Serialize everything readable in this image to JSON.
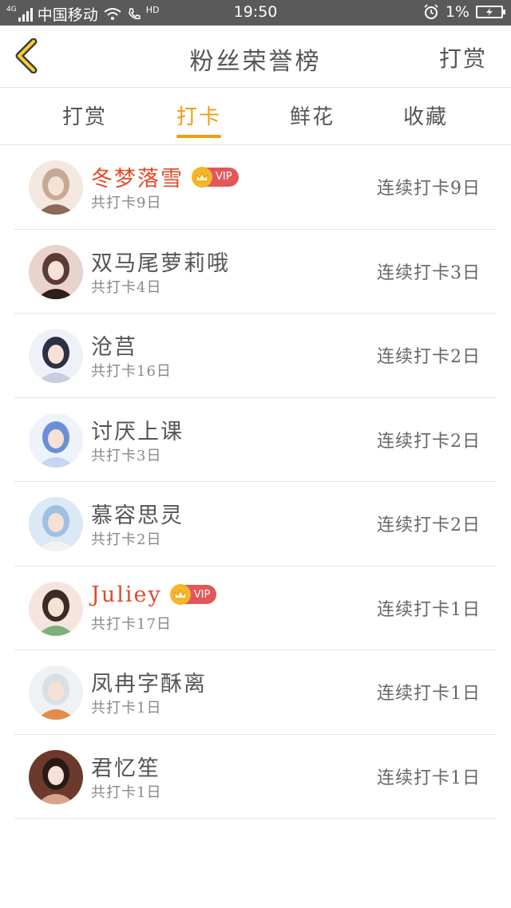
{
  "status_bar": {
    "network_type": "4G",
    "carrier": "中国移动",
    "hd_label": "HD",
    "time": "19:50",
    "battery_percent": "1%"
  },
  "header": {
    "back_icon": "chevron-left-icon",
    "title": "粉丝荣誉榜",
    "action_label": "打赏"
  },
  "tabs": [
    {
      "label": "打赏",
      "active": false
    },
    {
      "label": "打卡",
      "active": true
    },
    {
      "label": "鲜花",
      "active": false
    },
    {
      "label": "收藏",
      "active": false
    }
  ],
  "accent_color": "#f39c12",
  "vip_name_color": "#e14b2a",
  "vip_badge_label": "VIP",
  "fans": [
    {
      "name": "冬梦落雪",
      "vip": true,
      "total": "共打卡9日",
      "streak": "连续打卡9日",
      "avatar_colors": [
        "#f3e7df",
        "#c7a895",
        "#8a6a5c"
      ]
    },
    {
      "name": "双马尾萝莉哦",
      "vip": false,
      "total": "共打卡4日",
      "streak": "连续打卡3日",
      "avatar_colors": [
        "#e8d3cd",
        "#5b3b35",
        "#2e1e1c"
      ]
    },
    {
      "name": "沧莒",
      "vip": false,
      "total": "共打卡16日",
      "streak": "连续打卡2日",
      "avatar_colors": [
        "#eef1f8",
        "#2c3043",
        "#c8cede"
      ]
    },
    {
      "name": "讨厌上课",
      "vip": false,
      "total": "共打卡3日",
      "streak": "连续打卡2日",
      "avatar_colors": [
        "#eef3fb",
        "#6b8fd6",
        "#c8d5f0"
      ]
    },
    {
      "name": "慕容思灵",
      "vip": false,
      "total": "共打卡2日",
      "streak": "连续打卡2日",
      "avatar_colors": [
        "#dbe9f6",
        "#9fc0e3",
        "#f2f2f6"
      ]
    },
    {
      "name": "Juliey",
      "vip": true,
      "total": "共打卡17日",
      "streak": "连续打卡1日",
      "avatar_colors": [
        "#f5e4e0",
        "#3b2a26",
        "#7fb07b"
      ]
    },
    {
      "name": "凤冉字酥离",
      "vip": false,
      "total": "共打卡1日",
      "streak": "连续打卡1日",
      "avatar_colors": [
        "#eef2f4",
        "#d7e0e6",
        "#e58a4a"
      ]
    },
    {
      "name": "君忆笙",
      "vip": false,
      "total": "共打卡1日",
      "streak": "连续打卡1日",
      "avatar_colors": [
        "#6b3a2c",
        "#2a1a16",
        "#d9a58a"
      ]
    }
  ]
}
